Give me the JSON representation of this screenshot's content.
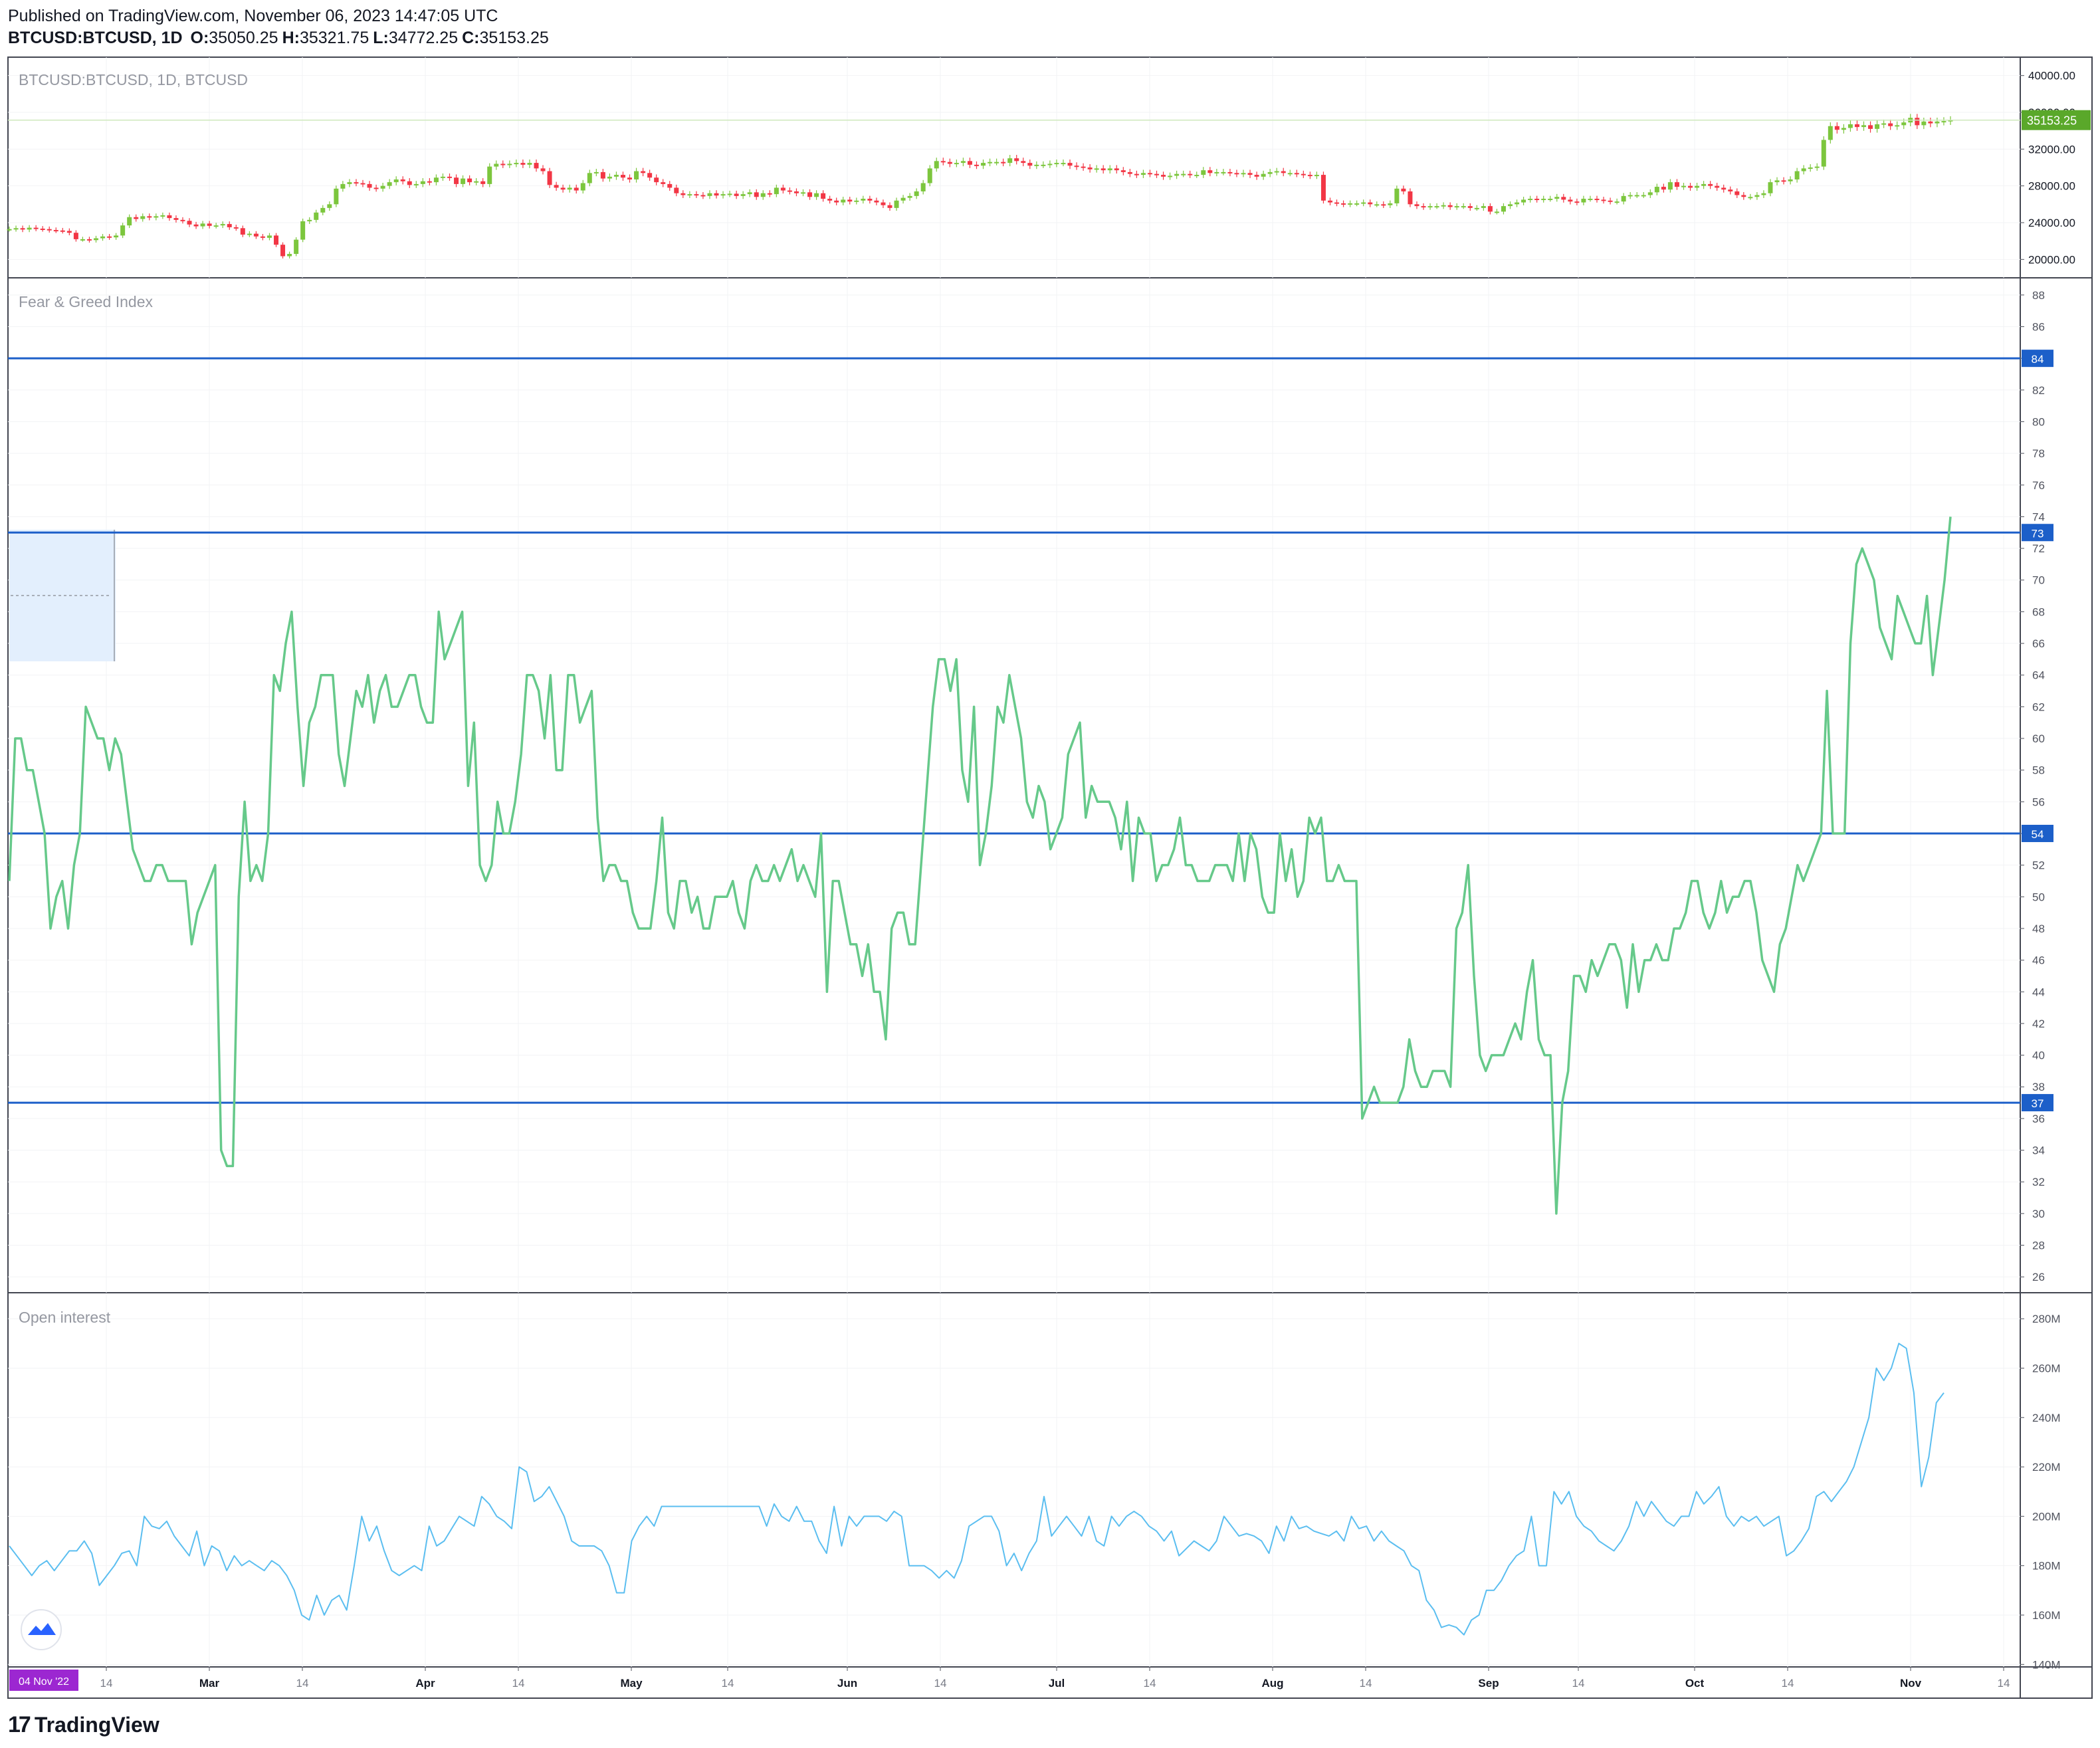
{
  "header": {
    "published": "Published on TradingView.com, November 06, 2023 14:47:05 UTC",
    "symbol": "BTCUSD:BTCUSD, 1D",
    "o_label": "O:",
    "o_value": "35050.25",
    "h_label": "H:",
    "h_value": "35321.75",
    "l_label": "L:",
    "l_value": "34772.25",
    "c_label": "C:",
    "c_value": "35153.25"
  },
  "footer": {
    "brand": "TradingView"
  },
  "colors": {
    "up": "#7cc63d",
    "down": "#f23645",
    "fg_line": "#66c98a",
    "oi_line": "#5bbef0",
    "hline": "#1c5fc9",
    "accent_price": "#5aa82a",
    "date_badge": "#9c27d1",
    "border": "#434651",
    "grid": "#f2f3f5"
  },
  "chart_data": [
    {
      "type": "candlestick",
      "title": "BTCUSD:BTCUSD, 1D, BTCUSD",
      "ylim": [
        18000,
        42000
      ],
      "yticks": [
        "20000.00",
        "24000.00",
        "28000.00",
        "32000.00",
        "36000.00",
        "40000.00"
      ],
      "last_price": "35153.25",
      "closes": [
        23300,
        23400,
        23250,
        23450,
        23350,
        23300,
        23200,
        23150,
        23100,
        22900,
        22200,
        22200,
        22100,
        22300,
        22500,
        22400,
        22600,
        23700,
        24600,
        24400,
        24700,
        24550,
        24700,
        24800,
        24500,
        24300,
        24200,
        23800,
        23600,
        23900,
        23650,
        23700,
        23850,
        23500,
        23400,
        22700,
        22800,
        22500,
        22350,
        22600,
        21600,
        20350,
        20600,
        22150,
        24150,
        24300,
        25100,
        25600,
        26000,
        27700,
        28200,
        28400,
        28300,
        28200,
        27800,
        27700,
        28000,
        28400,
        28700,
        28500,
        28100,
        28200,
        28500,
        28400,
        28900,
        29000,
        28900,
        28200,
        28800,
        28400,
        28500,
        28200,
        30100,
        30400,
        30300,
        30400,
        30500,
        30300,
        30500,
        29900,
        29600,
        28100,
        27800,
        27600,
        27800,
        27500,
        28300,
        29400,
        29500,
        28800,
        29000,
        29200,
        28900,
        28700,
        29600,
        29400,
        28900,
        28400,
        28200,
        27800,
        27200,
        27000,
        27100,
        27000,
        26900,
        27200,
        26950,
        27100,
        27150,
        26900,
        27100,
        27300,
        26800,
        27200,
        27100,
        27800,
        27500,
        27400,
        27200,
        27300,
        26800,
        27200,
        26600,
        26400,
        26200,
        26500,
        26300,
        26400,
        26600,
        26400,
        26200,
        25900,
        25600,
        26400,
        26700,
        26900,
        27400,
        28300,
        29900,
        30700,
        30600,
        30400,
        30500,
        30700,
        30300,
        30200,
        30500,
        30600,
        30600,
        30500,
        31000,
        30700,
        30500,
        30200,
        30300,
        30300,
        30400,
        30500,
        30500,
        30200,
        30100,
        30000,
        29800,
        29900,
        29700,
        29900,
        29700,
        29500,
        29300,
        29200,
        29400,
        29300,
        29200,
        29000,
        29100,
        29300,
        29300,
        29200,
        29200,
        29700,
        29400,
        29500,
        29500,
        29400,
        29300,
        29400,
        29200,
        29000,
        29300,
        29500,
        29600,
        29400,
        29400,
        29300,
        29200,
        29100,
        29200,
        26400,
        26200,
        26100,
        26000,
        26100,
        26100,
        26200,
        26000,
        26000,
        25900,
        26100,
        27700,
        27400,
        26000,
        25800,
        25700,
        25800,
        25800,
        25900,
        25700,
        25800,
        25800,
        25600,
        25600,
        25800,
        25200,
        25200,
        25800,
        26000,
        26200,
        26500,
        26600,
        26500,
        26600,
        26600,
        26800,
        26500,
        26300,
        26200,
        26600,
        26600,
        26500,
        26400,
        26300,
        26300,
        26900,
        27000,
        27000,
        27000,
        27300,
        27900,
        27600,
        28400,
        27900,
        28000,
        27800,
        28000,
        28200,
        28000,
        27800,
        27600,
        27400,
        27000,
        26800,
        26800,
        27000,
        27200,
        28400,
        28600,
        28500,
        28700,
        29600,
        29900,
        30000,
        30100,
        33000,
        34500,
        34100,
        34300,
        34700,
        34400,
        34600,
        34200,
        34700,
        34800,
        34500,
        34600,
        34900,
        35400,
        34600,
        35000,
        34800,
        35000,
        35050,
        35153
      ]
    },
    {
      "type": "line",
      "title": "Fear & Greed Index",
      "ylim": [
        25,
        89
      ],
      "yticks": [
        26,
        28,
        30,
        32,
        34,
        36,
        38,
        40,
        42,
        44,
        46,
        48,
        50,
        52,
        54,
        56,
        58,
        60,
        62,
        64,
        66,
        68,
        70,
        72,
        74,
        76,
        78,
        80,
        82,
        84,
        86,
        88
      ],
      "hlines": [
        84,
        73,
        54,
        37
      ],
      "values": [
        51,
        60,
        60,
        58,
        58,
        56,
        54,
        48,
        50,
        51,
        48,
        52,
        54,
        62,
        61,
        60,
        60,
        58,
        60,
        59,
        56,
        53,
        52,
        51,
        51,
        52,
        52,
        51,
        51,
        51,
        51,
        47,
        49,
        50,
        51,
        52,
        34,
        33,
        33,
        50,
        56,
        51,
        52,
        51,
        54,
        64,
        63,
        66,
        68,
        62,
        57,
        61,
        62,
        64,
        64,
        64,
        59,
        57,
        60,
        63,
        62,
        64,
        61,
        63,
        64,
        62,
        62,
        63,
        64,
        64,
        62,
        61,
        61,
        68,
        65,
        66,
        67,
        68,
        57,
        61,
        52,
        51,
        52,
        56,
        54,
        54,
        56,
        59,
        64,
        64,
        63,
        60,
        64,
        58,
        58,
        64,
        64,
        61,
        62,
        63,
        55,
        51,
        52,
        52,
        51,
        51,
        49,
        48,
        48,
        48,
        51,
        55,
        49,
        48,
        51,
        51,
        49,
        50,
        48,
        48,
        50,
        50,
        50,
        51,
        49,
        48,
        51,
        52,
        51,
        51,
        52,
        51,
        52,
        53,
        51,
        52,
        51,
        50,
        54,
        44,
        51,
        51,
        49,
        47,
        47,
        45,
        47,
        44,
        44,
        41,
        48,
        49,
        49,
        47,
        47,
        52,
        57,
        62,
        65,
        65,
        63,
        65,
        58,
        56,
        62,
        52,
        54,
        57,
        62,
        61,
        64,
        62,
        60,
        56,
        55,
        57,
        56,
        53,
        54,
        55,
        59,
        60,
        61,
        55,
        57,
        56,
        56,
        56,
        55,
        53,
        56,
        51,
        55,
        54,
        54,
        51,
        52,
        52,
        53,
        55,
        52,
        52,
        51,
        51,
        51,
        52,
        52,
        52,
        51,
        54,
        51,
        54,
        53,
        50,
        49,
        49,
        54,
        51,
        53,
        50,
        51,
        55,
        54,
        55,
        51,
        51,
        52,
        51,
        51,
        51,
        36,
        37,
        38,
        37,
        37,
        37,
        37,
        38,
        41,
        39,
        38,
        38,
        39,
        39,
        39,
        38,
        48,
        49,
        52,
        45,
        40,
        39,
        40,
        40,
        40,
        41,
        42,
        41,
        44,
        46,
        41,
        40,
        40,
        30,
        37,
        39,
        45,
        45,
        44,
        46,
        45,
        46,
        47,
        47,
        46,
        43,
        47,
        44,
        46,
        46,
        47,
        46,
        46,
        48,
        48,
        49,
        51,
        51,
        49,
        48,
        49,
        51,
        49,
        50,
        50,
        51,
        51,
        49,
        46,
        45,
        44,
        47,
        48,
        50,
        52,
        51,
        52,
        53,
        54,
        63,
        54,
        54,
        54,
        66,
        71,
        72,
        71,
        70,
        67,
        66,
        65,
        69,
        68,
        67,
        66,
        66,
        69,
        64,
        67,
        70,
        74
      ]
    },
    {
      "type": "line",
      "title": "Open interest",
      "ylim": [
        139000000,
        290000000
      ],
      "yticks": [
        "140M",
        "160M",
        "180M",
        "200M",
        "220M",
        "240M",
        "260M",
        "280M"
      ],
      "values": [
        188,
        184,
        180,
        176,
        180,
        182,
        178,
        182,
        186,
        186,
        190,
        185,
        172,
        176,
        180,
        185,
        186,
        180,
        200,
        196,
        195,
        198,
        192,
        188,
        184,
        194,
        180,
        188,
        186,
        178,
        184,
        180,
        182,
        180,
        178,
        182,
        180,
        176,
        170,
        160,
        158,
        168,
        160,
        166,
        168,
        162,
        180,
        200,
        190,
        196,
        186,
        178,
        176,
        178,
        180,
        178,
        196,
        188,
        190,
        195,
        200,
        198,
        196,
        208,
        205,
        200,
        198,
        195,
        220,
        218,
        206,
        208,
        212,
        206,
        200,
        190,
        188,
        188,
        188,
        186,
        180,
        169,
        169,
        190,
        196,
        200,
        196,
        204,
        204,
        204,
        204,
        204,
        204,
        204,
        204,
        204,
        204,
        204,
        204,
        204,
        204,
        196,
        205,
        200,
        198,
        204,
        198,
        198,
        190,
        185,
        204,
        188,
        200,
        196,
        200,
        200,
        200,
        198,
        202,
        200,
        180,
        180,
        180,
        178,
        175,
        178,
        175,
        182,
        196,
        198,
        200,
        200,
        194,
        180,
        185,
        178,
        185,
        190,
        208,
        192,
        196,
        200,
        196,
        192,
        200,
        190,
        188,
        200,
        196,
        200,
        202,
        200,
        196,
        194,
        190,
        194,
        184,
        187,
        190,
        188,
        186,
        190,
        200,
        196,
        192,
        193,
        192,
        190,
        185,
        196,
        190,
        200,
        195,
        196,
        194,
        193,
        192,
        194,
        190,
        200,
        195,
        196,
        190,
        194,
        190,
        188,
        186,
        180,
        178,
        166,
        162,
        155,
        156,
        155,
        152,
        158,
        160,
        170,
        170,
        174,
        180,
        184,
        186,
        200,
        180,
        180,
        210,
        205,
        210,
        200,
        196,
        194,
        190,
        188,
        186,
        190,
        196,
        206,
        200,
        206,
        202,
        198,
        196,
        200,
        200,
        210,
        205,
        208,
        212,
        200,
        196,
        200,
        198,
        200,
        196,
        198,
        200,
        184,
        186,
        190,
        195,
        208,
        210,
        206,
        210,
        214,
        220,
        230,
        240,
        260,
        255,
        260,
        270,
        268,
        250,
        212,
        224,
        246,
        250
      ]
    },
    {
      "type": "axis",
      "x_ticks": [
        "14",
        "Mar",
        "14",
        "Apr",
        "14",
        "May",
        "14",
        "Jun",
        "14",
        "Jul",
        "14",
        "Aug",
        "14",
        "Sep",
        "14",
        "Oct",
        "14",
        "Nov",
        "14"
      ],
      "date_badge": "04 Nov '22"
    }
  ]
}
